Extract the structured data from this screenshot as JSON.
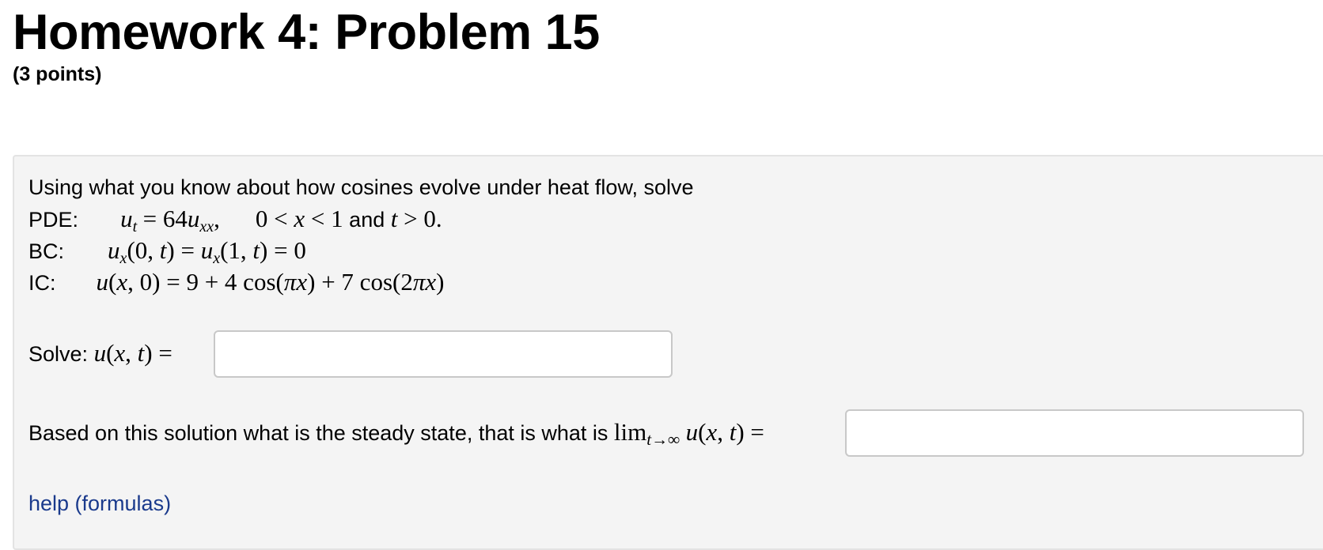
{
  "header": {
    "title": "Homework 4: Problem 15",
    "points": "(3 points)"
  },
  "problem": {
    "intro": "Using what you know about how cosines evolve under heat flow, solve",
    "pde_label": "PDE:",
    "pde_domain_and": "and",
    "bc_label": "BC:",
    "ic_label": "IC:",
    "solve_label": "Solve:",
    "steady_label": "Based on this solution what is the steady state, that is what is"
  },
  "answers": {
    "solution_value": "",
    "steady_state_value": ""
  },
  "links": {
    "help": "help (formulas)"
  }
}
